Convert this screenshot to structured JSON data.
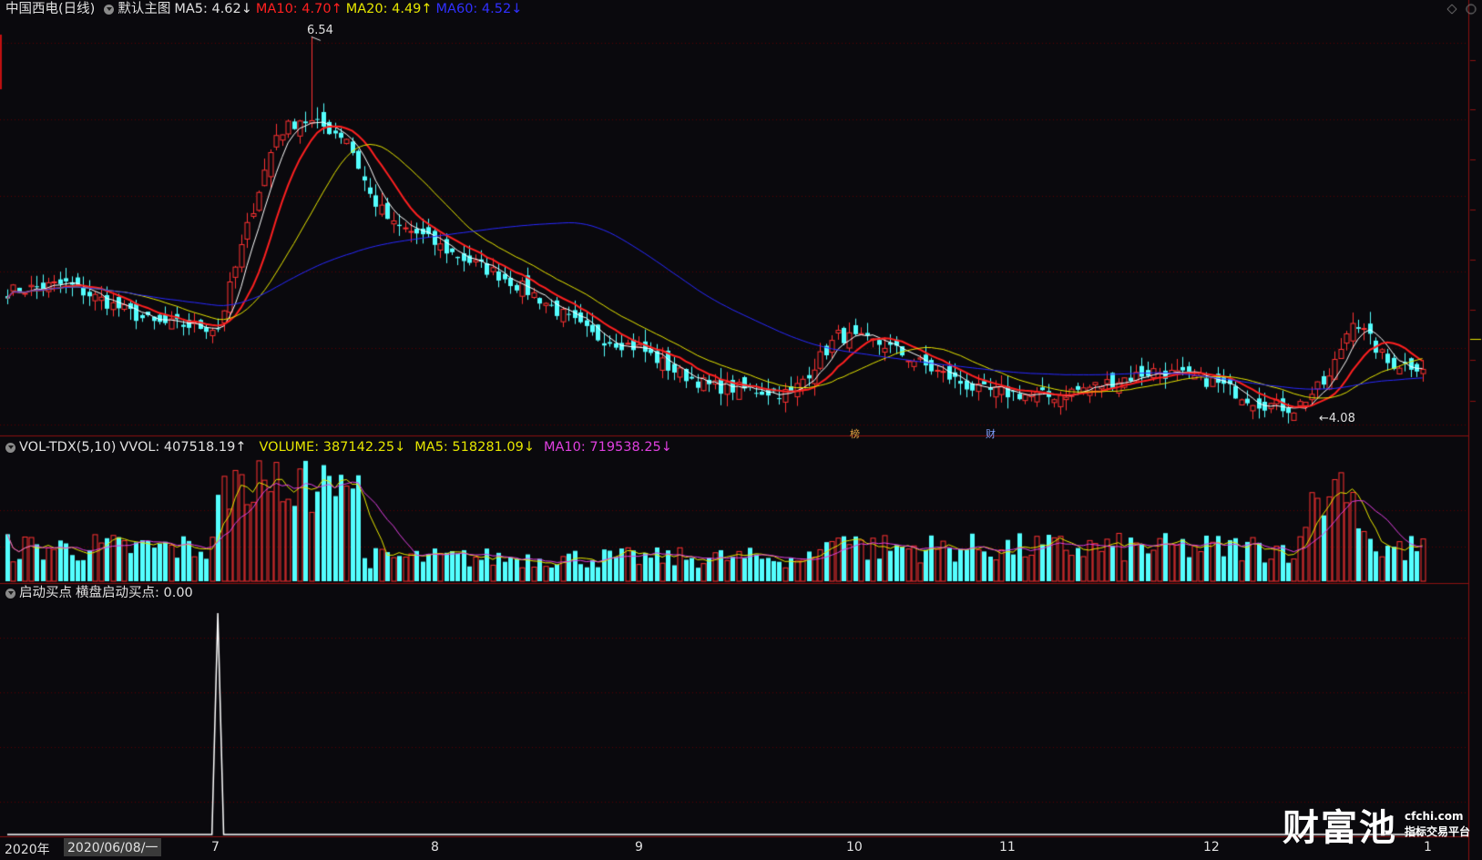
{
  "main_header": {
    "stock_name": "中国西电(日线)",
    "template": "默认主图",
    "ma5": "MA5: 4.62↓",
    "ma10": "MA10: 4.70↑",
    "ma20": "MA20: 4.49↑",
    "ma60": "MA60: 4.52↓"
  },
  "vol_header": {
    "indicator": "VOL-TDX(5,10)",
    "vvol": "VVOL: 407518.19↑",
    "volume": "VOLUME: 387142.25↓",
    "ma5": "MA5: 518281.09↓",
    "ma10": "MA10: 719538.25↓"
  },
  "ind_header": {
    "indicator": "启动买点",
    "value": "横盘启动买点: 0.00"
  },
  "annotations": {
    "high": "6.54",
    "low": "←4.08",
    "bang": "榜",
    "cai": "财"
  },
  "x_axis": {
    "year": "2020年",
    "cursor_date": "2020/06/08/一",
    "months": [
      "7",
      "8",
      "9",
      "10",
      "11",
      "12",
      "1"
    ]
  },
  "logo": {
    "name": "财富池",
    "site": "cfchi.com",
    "slogan": "指标交易平台"
  },
  "colors": {
    "up": "#ff3232",
    "down": "#54ffff",
    "ma5": "#ffffff",
    "ma10": "#ff2020",
    "ma20": "#e6e600",
    "ma60": "#2828ff",
    "vol_ma10": "#e040e0",
    "grid": "#5a0000"
  },
  "chart_data": {
    "type": "candlestick",
    "period": "daily",
    "approx_close_path": [
      [
        0,
        4.87
      ],
      [
        10,
        4.92
      ],
      [
        18,
        4.78
      ],
      [
        25,
        4.66
      ],
      [
        30,
        4.65
      ],
      [
        36,
        4.63
      ],
      [
        42,
        5.42
      ],
      [
        46,
        5.9
      ],
      [
        50,
        6.0
      ],
      [
        54,
        5.95
      ],
      [
        58,
        5.88
      ],
      [
        62,
        5.5
      ],
      [
        66,
        5.3
      ],
      [
        70,
        5.25
      ],
      [
        76,
        5.12
      ],
      [
        84,
        4.98
      ],
      [
        90,
        4.85
      ],
      [
        100,
        4.58
      ],
      [
        108,
        4.5
      ],
      [
        114,
        4.35
      ],
      [
        120,
        4.25
      ],
      [
        134,
        4.2
      ],
      [
        142,
        4.58
      ],
      [
        150,
        4.52
      ],
      [
        158,
        4.36
      ],
      [
        166,
        4.22
      ],
      [
        178,
        4.18
      ],
      [
        186,
        4.25
      ],
      [
        196,
        4.35
      ],
      [
        206,
        4.28
      ],
      [
        214,
        4.14
      ],
      [
        220,
        4.1
      ],
      [
        226,
        4.3
      ],
      [
        230,
        4.7
      ],
      [
        236,
        4.4
      ],
      [
        242,
        4.38
      ]
    ],
    "high_marker": 6.54,
    "low_marker": 4.08,
    "ma_last": {
      "MA5": 4.62,
      "MA10": 4.7,
      "MA20": 4.49,
      "MA60": 4.52
    },
    "volume_last": {
      "VVOL": 407518.19,
      "VOLUME": 387142.25,
      "MA5": 518281.09,
      "MA10": 719538.25
    },
    "signal_last": 0.0,
    "signal_peak_index": 36
  }
}
